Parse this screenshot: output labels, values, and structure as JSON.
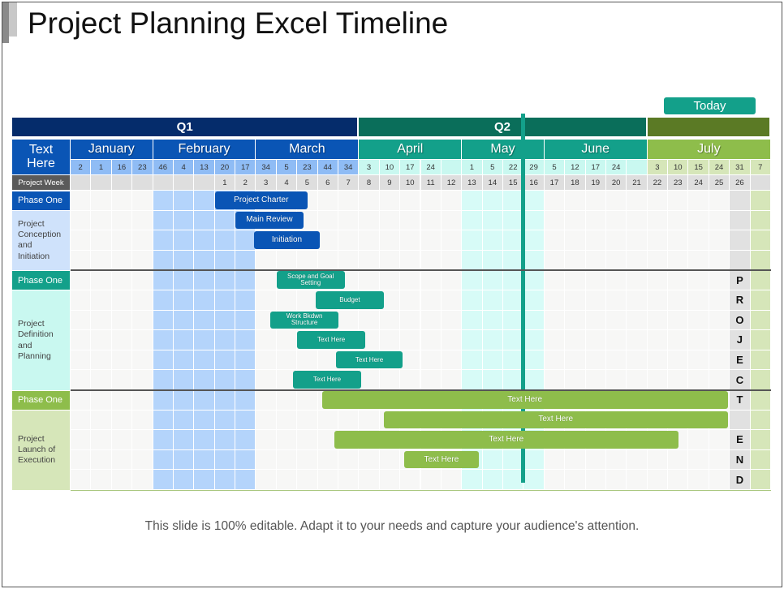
{
  "title": "Project Planning Excel Timeline",
  "footer": "This slide is 100% editable. Adapt it to your needs and capture your audience's attention.",
  "colors": {
    "q1": "#052c6b",
    "q2": "#0a6e5a",
    "q3": "#5b7a25",
    "jan_feb_mar": "#0a55b5",
    "apr_may_jun": "#13a08a",
    "jul": "#8ebd4b",
    "today": "#13a08a"
  },
  "chart_data": {
    "type": "gantt",
    "title": "Project Planning Excel Timeline",
    "header_label": "Text Here",
    "project_week_label": "Project Week",
    "today_label": "Today",
    "today_week": 22.5,
    "quarters": [
      {
        "label": "Q1",
        "months": 3
      },
      {
        "label": "Q2",
        "months": 3
      },
      {
        "label": "",
        "months": 1
      }
    ],
    "months": [
      {
        "label": "January",
        "days": [
          "2",
          "1",
          "16",
          "23"
        ],
        "theme": "blue"
      },
      {
        "label": "February",
        "days": [
          "46",
          "4",
          "13",
          "20",
          "17"
        ],
        "theme": "blue"
      },
      {
        "label": "March",
        "days": [
          "34",
          "5",
          "23",
          "44",
          "34"
        ],
        "theme": "blue"
      },
      {
        "label": "April",
        "days": [
          "3",
          "10",
          "17",
          "24",
          ""
        ],
        "theme": "teal"
      },
      {
        "label": "May",
        "days": [
          "1",
          "5",
          "22",
          "29"
        ],
        "theme": "teal"
      },
      {
        "label": "June",
        "days": [
          "5",
          "12",
          "17",
          "24",
          ""
        ],
        "theme": "teal"
      },
      {
        "label": "July",
        "days": [
          "3",
          "10",
          "15",
          "24",
          "31",
          "7"
        ],
        "theme": "green"
      }
    ],
    "project_weeks": [
      "",
      "",
      "",
      "",
      "",
      "",
      "",
      "1",
      "2",
      "3",
      "4",
      "5",
      "6",
      "7",
      "8",
      "9",
      "10",
      "11",
      "12",
      "13",
      "14",
      "15",
      "16",
      "17",
      "18",
      "19",
      "20",
      "21",
      "22",
      "23",
      "24",
      "25",
      "26",
      ""
    ],
    "phases": [
      {
        "tag": "Phase One",
        "name": "Project Conception and Initiation",
        "theme": "blue",
        "rows": 4
      },
      {
        "tag": "Phase One",
        "name": "Project Definition and Planning",
        "theme": "teal",
        "rows": 6
      },
      {
        "tag": "Phase One",
        "name": "Project Launch of Execution",
        "theme": "green",
        "rows": 5
      }
    ],
    "tasks": [
      {
        "label": "Project Charter",
        "row": 0,
        "start_col": 7.0,
        "end_col": 11.5,
        "theme": "blue"
      },
      {
        "label": "Main Review",
        "row": 1,
        "start_col": 8.0,
        "end_col": 11.3,
        "theme": "blue"
      },
      {
        "label": "Initiation",
        "row": 2,
        "start_col": 8.9,
        "end_col": 12.1,
        "theme": "blue"
      },
      {
        "label": "Scope and Goal Setting",
        "row": 4,
        "start_col": 10.0,
        "end_col": 13.3,
        "theme": "teal"
      },
      {
        "label": "Budget",
        "row": 5,
        "start_col": 11.9,
        "end_col": 15.2,
        "theme": "teal"
      },
      {
        "label": "Work Bkdwn Structure",
        "row": 6,
        "start_col": 9.7,
        "end_col": 13.0,
        "theme": "teal"
      },
      {
        "label": "Text Here",
        "row": 7,
        "start_col": 11.0,
        "end_col": 14.3,
        "theme": "teal"
      },
      {
        "label": "Text Here",
        "row": 8,
        "start_col": 12.9,
        "end_col": 16.1,
        "theme": "teal"
      },
      {
        "label": "Text Here",
        "row": 9,
        "start_col": 10.8,
        "end_col": 14.1,
        "theme": "teal"
      },
      {
        "label": "Text Here",
        "row": 10,
        "start_col": 12.2,
        "end_col": 31.9,
        "theme": "green"
      },
      {
        "label": "Text Here",
        "row": 11,
        "start_col": 15.2,
        "end_col": 31.9,
        "theme": "green"
      },
      {
        "label": "Text Here",
        "row": 12,
        "start_col": 12.8,
        "end_col": 29.5,
        "theme": "green"
      },
      {
        "label": "Text Here",
        "row": 13,
        "start_col": 16.2,
        "end_col": 19.8,
        "theme": "green"
      }
    ],
    "end_marker_letters": [
      "P",
      "R",
      "O",
      "J",
      "E",
      "C",
      "T",
      "",
      "E",
      "N",
      "D"
    ]
  }
}
